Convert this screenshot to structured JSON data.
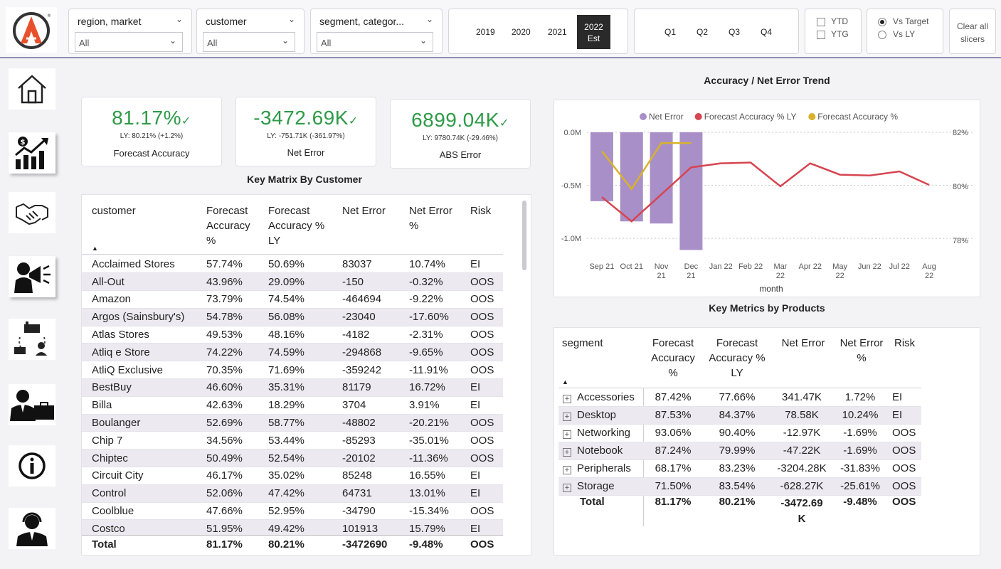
{
  "slicers": {
    "region": {
      "title": "region, market",
      "value": "All"
    },
    "customer": {
      "title": "customer",
      "value": "All"
    },
    "segment": {
      "title": "segment, categor...",
      "value": "All"
    },
    "years": [
      "2019",
      "2020",
      "2021"
    ],
    "active_year": {
      "line1": "2022",
      "line2": "Est"
    },
    "quarters": [
      "Q1",
      "Q2",
      "Q3",
      "Q4"
    ],
    "ytd": "YTD",
    "ytg": "YTG",
    "vs_target": "Vs Target",
    "vs_ly": "Vs LY",
    "clear": {
      "line1": "Clear all",
      "line2": "slicers"
    }
  },
  "kpis": [
    {
      "value": "81.17%",
      "ly": "LY: 80.21% (+1.2%)",
      "name": "Forecast Accuracy"
    },
    {
      "value": "-3472.69K",
      "ly": "LY: -751.71K (-361.97%)",
      "name": "Net Error"
    },
    {
      "value": "6899.04K",
      "ly": "LY: 9780.74K (-29.46%)",
      "name": "ABS Error"
    }
  ],
  "customer_matrix": {
    "title": "Key Matrix By Customer",
    "headers": [
      "customer",
      "Forecast Accuracy %",
      "Forecast Accuracy % LY",
      "Net Error",
      "Net Error %",
      "Risk"
    ],
    "header_lines": {
      "fa": [
        "Forecast",
        "Accuracy",
        "%"
      ],
      "faly": [
        "Forecast",
        "Accuracy %",
        "LY"
      ],
      "ne": [
        "Net Error"
      ],
      "nep": [
        "Net Error",
        "%"
      ]
    },
    "rows": [
      [
        "Acclaimed Stores",
        "57.74%",
        "50.69%",
        "83037",
        "10.74%",
        "EI"
      ],
      [
        "All-Out",
        "43.96%",
        "29.09%",
        "-150",
        "-0.32%",
        "OOS"
      ],
      [
        "Amazon",
        "73.79%",
        "74.54%",
        "-464694",
        "-9.22%",
        "OOS"
      ],
      [
        "Argos (Sainsbury's)",
        "54.78%",
        "56.08%",
        "-23040",
        "-17.60%",
        "OOS"
      ],
      [
        "Atlas Stores",
        "49.53%",
        "48.16%",
        "-4182",
        "-2.31%",
        "OOS"
      ],
      [
        "Atliq e Store",
        "74.22%",
        "74.59%",
        "-294868",
        "-9.65%",
        "OOS"
      ],
      [
        "AtliQ Exclusive",
        "70.35%",
        "71.69%",
        "-359242",
        "-11.91%",
        "OOS"
      ],
      [
        "BestBuy",
        "46.60%",
        "35.31%",
        "81179",
        "16.72%",
        "EI"
      ],
      [
        "Billa",
        "42.63%",
        "18.29%",
        "3704",
        "3.91%",
        "EI"
      ],
      [
        "Boulanger",
        "52.69%",
        "58.77%",
        "-48802",
        "-20.21%",
        "OOS"
      ],
      [
        "Chip 7",
        "34.56%",
        "53.44%",
        "-85293",
        "-35.01%",
        "OOS"
      ],
      [
        "Chiptec",
        "50.49%",
        "52.54%",
        "-20102",
        "-11.36%",
        "OOS"
      ],
      [
        "Circuit City",
        "46.17%",
        "35.02%",
        "85248",
        "16.55%",
        "EI"
      ],
      [
        "Control",
        "52.06%",
        "47.42%",
        "64731",
        "13.01%",
        "EI"
      ],
      [
        "Coolblue",
        "47.66%",
        "52.95%",
        "-34790",
        "-15.34%",
        "OOS"
      ],
      [
        "Costco",
        "51.95%",
        "49.42%",
        "101913",
        "15.79%",
        "EI"
      ]
    ],
    "total": [
      "Total",
      "81.17%",
      "80.21%",
      "-3472690",
      "-9.48%",
      "OOS"
    ]
  },
  "product_matrix": {
    "title": "Key Metrics by Products",
    "header_lines": {
      "seg": [
        "segment"
      ],
      "fa": [
        "Forecast",
        "Accuracy",
        "%"
      ],
      "faly": [
        "Forecast",
        "Accuracy %",
        "LY"
      ],
      "ne": [
        "Net Error"
      ],
      "nep": [
        "Net Error",
        "%"
      ],
      "risk": [
        "Risk"
      ]
    },
    "rows": [
      [
        "Accessories",
        "87.42%",
        "77.66%",
        "341.47K",
        "1.72%",
        "EI"
      ],
      [
        "Desktop",
        "87.53%",
        "84.37%",
        "78.58K",
        "10.24%",
        "EI"
      ],
      [
        "Networking",
        "93.06%",
        "90.40%",
        "-12.97K",
        "-1.69%",
        "OOS"
      ],
      [
        "Notebook",
        "87.24%",
        "79.99%",
        "-47.22K",
        "-1.69%",
        "OOS"
      ],
      [
        "Peripherals",
        "68.17%",
        "83.23%",
        "-3204.28K",
        "-31.83%",
        "OOS"
      ],
      [
        "Storage",
        "71.50%",
        "83.54%",
        "-628.27K",
        "-25.61%",
        "OOS"
      ]
    ],
    "total": [
      "Total",
      "81.17%",
      "80.21%",
      "-3472.69",
      "-9.48%",
      "OOS"
    ],
    "total_ne_line2": "K"
  },
  "chart_data": {
    "type": "bar",
    "title": "Accuracy / Net Error Trend",
    "xlabel": "month",
    "categories": [
      "Sep 21",
      "Oct 21",
      "Nov 21",
      "Dec 21",
      "Jan 22",
      "Feb 22",
      "Mar 22",
      "Apr 22",
      "May 22",
      "Jun 22",
      "Jul 22",
      "Aug 22"
    ],
    "category_labels": [
      [
        "Sep 21"
      ],
      [
        "Oct 21"
      ],
      [
        "Nov",
        "21"
      ],
      [
        "Dec",
        "21"
      ],
      [
        "Jan 22"
      ],
      [
        "Feb 22"
      ],
      [
        "Mar",
        "22"
      ],
      [
        "Apr 22"
      ],
      [
        "May",
        "22"
      ],
      [
        "Jun 22"
      ],
      [
        "Jul 22"
      ],
      [
        "Aug",
        "22"
      ]
    ],
    "y_left_ticks": [
      "0.0M",
      "-0.5M",
      "-1.0M"
    ],
    "y_left_range": [
      -1.12,
      0
    ],
    "y_right_ticks": [
      "82%",
      "80%",
      "78%"
    ],
    "y_right_range": [
      77.6,
      82.0
    ],
    "series": [
      {
        "name": "Net Error",
        "kind": "bar",
        "axis": "left",
        "color": "#a98fc8",
        "values": [
          -0.65,
          -0.84,
          -0.86,
          -1.11,
          null,
          null,
          null,
          null,
          null,
          null,
          null,
          null
        ]
      },
      {
        "name": "Forecast Accuracy % LY",
        "kind": "line",
        "axis": "right",
        "color": "#d64550",
        "values": [
          79.6,
          78.7,
          79.7,
          80.7,
          80.85,
          80.88,
          80.0,
          80.85,
          80.43,
          80.4,
          80.55,
          80.05
        ]
      },
      {
        "name": "Forecast Accuracy %",
        "kind": "line",
        "axis": "right",
        "color": "#d9b22a",
        "values": [
          81.3,
          79.9,
          81.6,
          81.6,
          null,
          null,
          null,
          null,
          null,
          null,
          null,
          null
        ]
      }
    ]
  }
}
